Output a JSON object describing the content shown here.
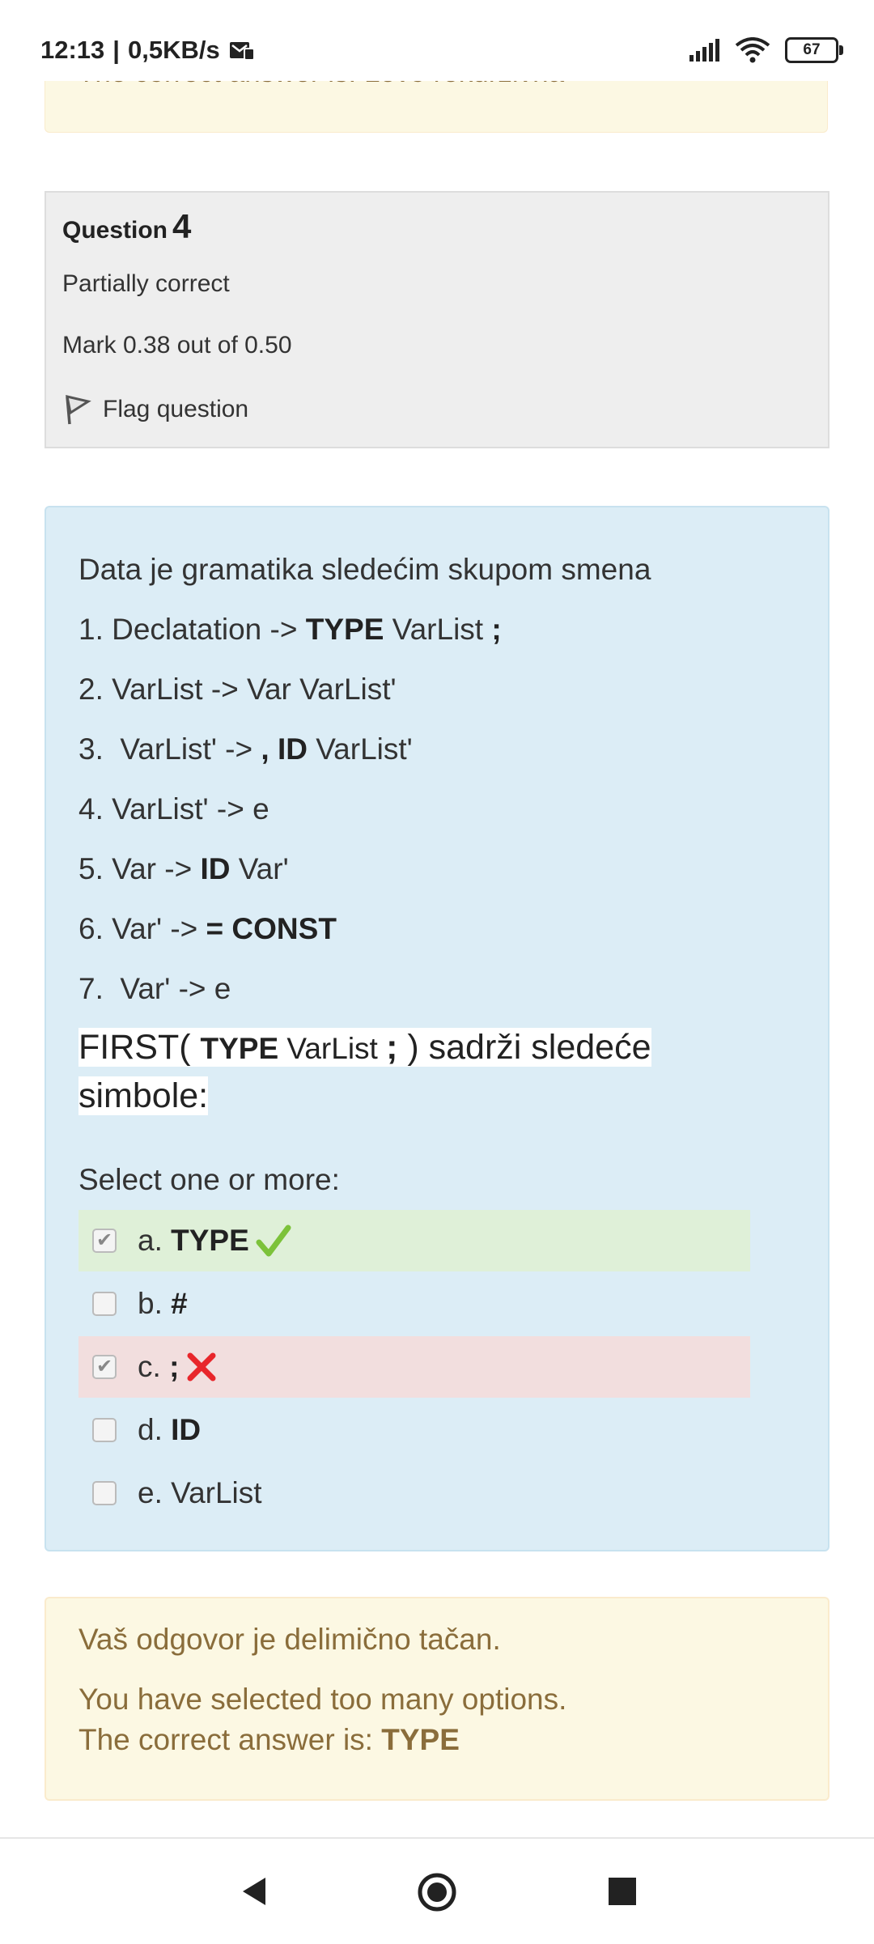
{
  "status_bar": {
    "time": "12:13",
    "net_speed": "0,5KB/s",
    "battery": "67"
  },
  "prev_feedback": {
    "text": "The correct answer is: Levo rekurzivna"
  },
  "question_info": {
    "label": "Question",
    "number": "4",
    "state": "Partially correct",
    "grade": "Mark 0.38 out of 0.50",
    "flag": "Flag question"
  },
  "question": {
    "intro": "Data je gramatika sledećim skupom smena",
    "rules": [
      {
        "pre": "1. Declatation -> ",
        "b1": "TYPE",
        "mid": " VarList ",
        "b2": ";",
        "post": ""
      },
      {
        "pre": "2. VarList -> Var VarList'",
        "b1": "",
        "mid": "",
        "b2": "",
        "post": ""
      },
      {
        "pre": "3.  VarList' -> ",
        "b1": ", ID",
        "mid": " VarList'",
        "b2": "",
        "post": ""
      },
      {
        "pre": "4. VarList' -> e",
        "b1": "",
        "mid": "",
        "b2": "",
        "post": ""
      },
      {
        "pre": "5. Var -> ",
        "b1": "ID",
        "mid": " Var'",
        "b2": "",
        "post": ""
      },
      {
        "pre": "6. Var' -> ",
        "b1": "= CONST",
        "mid": "",
        "b2": "",
        "post": ""
      },
      {
        "pre": "7.  Var' -> e",
        "b1": "",
        "mid": "",
        "b2": "",
        "post": ""
      }
    ],
    "first_pre": "FIRST( ",
    "first_type": "TYPE",
    "first_varlist": " VarList ",
    "first_semi": ";",
    "first_post": " ) sadrži sledeće",
    "first_line2": "simbole:",
    "prompt": "Select one or more:"
  },
  "answers": [
    {
      "letter": "a. ",
      "text": "TYPE",
      "checked": true,
      "state": "correct"
    },
    {
      "letter": "b. ",
      "text": "#",
      "checked": false,
      "state": "none"
    },
    {
      "letter": "c. ",
      "text": ";",
      "checked": true,
      "state": "incorrect"
    },
    {
      "letter": "d. ",
      "text": "ID",
      "checked": false,
      "state": "none"
    },
    {
      "letter": "e. ",
      "text": "VarList",
      "checked": false,
      "state": "none"
    }
  ],
  "feedback": {
    "line1": "Vaš odgovor je delimično tačan.",
    "line2": "You have selected too many options.",
    "line3_pre": "The correct answer is: ",
    "line3_answer": "TYPE"
  },
  "colors": {
    "content_bg": "#dcedf6",
    "correct_bg": "#dff0d8",
    "incorrect_bg": "#f2dede",
    "feedback_bg": "#fcf8e3",
    "check_green": "#7cc23a",
    "cross_red": "#e8262b"
  },
  "icons": {
    "flag": "flag-icon",
    "check": "check-icon",
    "cross": "cross-icon",
    "back": "back-triangle-icon",
    "home": "home-circle-icon",
    "recents": "recents-square-icon"
  }
}
